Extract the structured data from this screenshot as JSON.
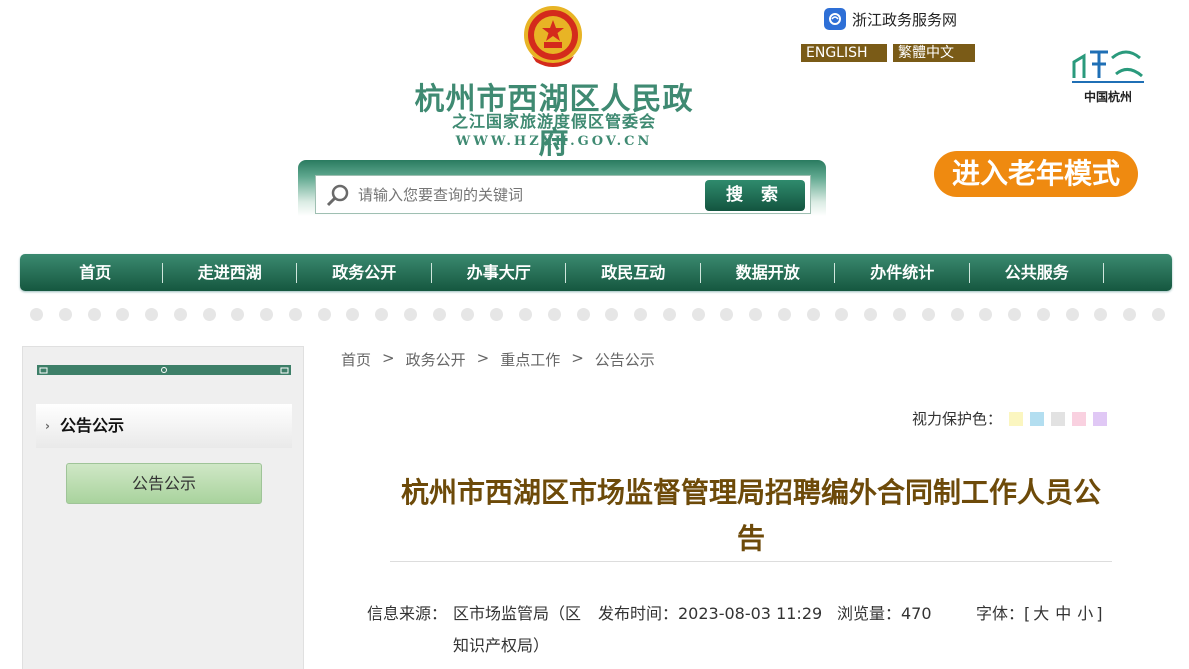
{
  "header": {
    "gov_name": "杭州市西湖区人民政府",
    "gov_subtitle": "之江国家旅游度假区管委会",
    "gov_url": "WWW.HZXH.GOV.CN",
    "zhejiang_service": "浙江政务服务网",
    "lang_english": "ENGLISH",
    "lang_traditional": "繁體中文",
    "city_logo_text": "中国杭州"
  },
  "search": {
    "placeholder": "请输入您要查询的关键词",
    "button": "搜 索"
  },
  "elderly_mode": "进入老年模式",
  "nav": {
    "items": [
      "首页",
      "走进西湖",
      "政务公开",
      "办事大厅",
      "政民互动",
      "数据开放",
      "办件统计",
      "公共服务"
    ]
  },
  "sidebar": {
    "heading": "公告公示",
    "button": "公告公示"
  },
  "breadcrumb": [
    "首页",
    "政务公开",
    "重点工作",
    "公告公示"
  ],
  "vision": {
    "label": "视力保护色：",
    "colors": [
      "#fbf6c0",
      "#b3def0",
      "#e2e2e2",
      "#f9d1e0",
      "#e0c8f5"
    ]
  },
  "article": {
    "title": "杭州市西湖区市场监督管理局招聘编外合同制工作人员公告",
    "source_label": "信息来源：",
    "source": "区市场监管局（区知识产权局）",
    "publish_time": "发布时间：2023-08-03 11:29",
    "views": "浏览量：470",
    "font_label": "字体：[",
    "font_large": "大",
    "font_medium": "中",
    "font_small": "小",
    "font_end": "]"
  },
  "colors": {
    "brand_green": "#15573f",
    "title_brown": "#6d4a09",
    "elderly_orange": "#ef8a10"
  }
}
